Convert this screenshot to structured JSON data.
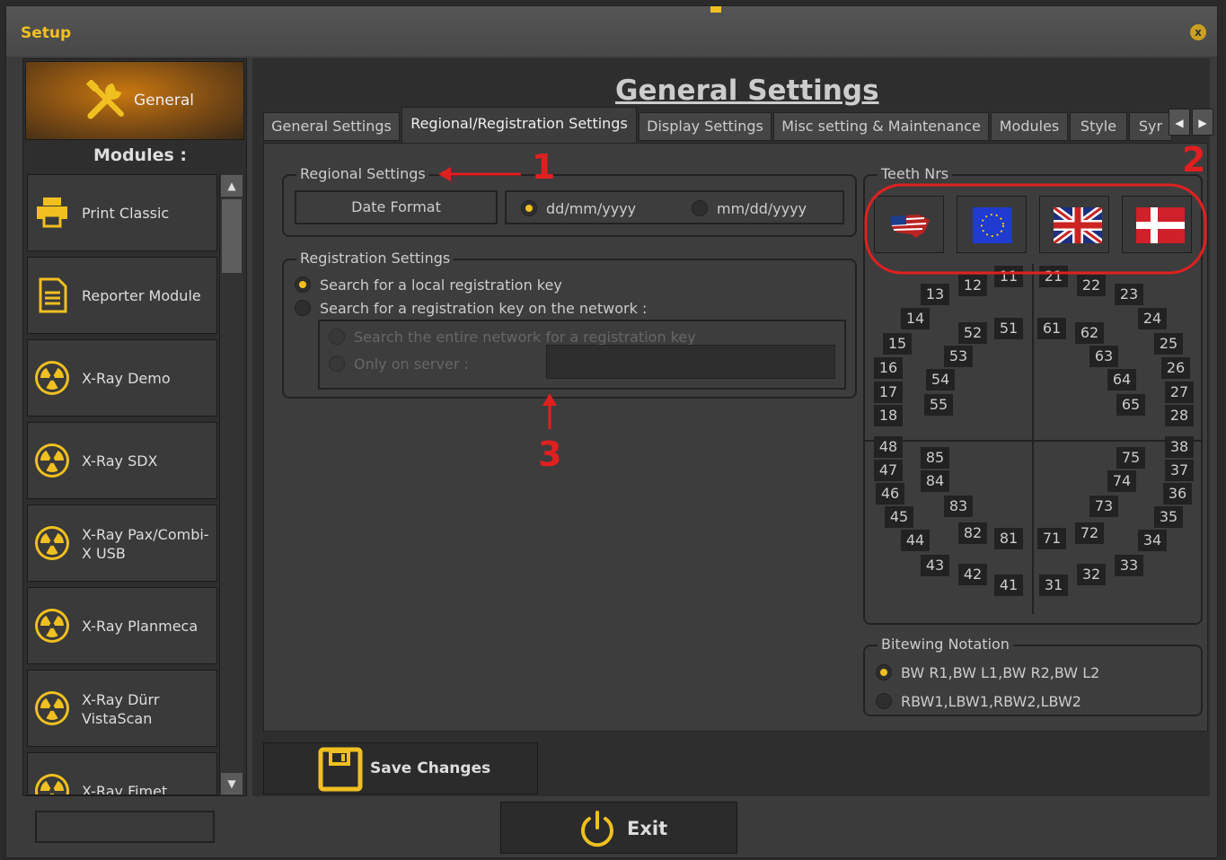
{
  "window": {
    "title": "Setup",
    "close_symbol": "x"
  },
  "sidebar": {
    "general_label": "General",
    "modules_heading": "Modules :",
    "items": [
      {
        "label": "Print Classic",
        "icon": "printer-icon"
      },
      {
        "label": "Reporter Module",
        "icon": "document-icon"
      },
      {
        "label": "X-Ray Demo",
        "icon": "radiation-icon"
      },
      {
        "label": "X-Ray SDX",
        "icon": "radiation-icon"
      },
      {
        "label": "X-Ray Pax/Combi-X USB",
        "icon": "radiation-icon"
      },
      {
        "label": "X-Ray Planmeca",
        "icon": "radiation-icon"
      },
      {
        "label": "X-Ray Dürr VistaScan",
        "icon": "radiation-icon"
      },
      {
        "label": "X-Ray Fimet",
        "icon": "radiation-icon"
      }
    ]
  },
  "main": {
    "title": "General Settings",
    "tabs": [
      {
        "label": "General Settings",
        "active": false
      },
      {
        "label": "Regional/Registration Settings",
        "active": true
      },
      {
        "label": "Display Settings",
        "active": false
      },
      {
        "label": "Misc setting & Maintenance",
        "active": false
      },
      {
        "label": "Modules",
        "active": false
      },
      {
        "label": "Style",
        "active": false
      },
      {
        "label": "Syr",
        "active": false
      }
    ],
    "regional": {
      "title": "Regional Settings",
      "date_format_label": "Date Format",
      "options": [
        "dd/mm/yyyy",
        "mm/dd/yyyy"
      ],
      "selected": "dd/mm/yyyy"
    },
    "registration": {
      "title": "Registration Settings",
      "options": [
        "Search for a local registration key",
        "Search for a registration key on the network :"
      ],
      "selected": "Search for a local registration key",
      "sub_options": [
        "Search the entire network for a registration key",
        "Only on server :"
      ],
      "server_value": ""
    },
    "teeth": {
      "title": "Teeth Nrs",
      "flags": [
        "usa-flag-icon",
        "eu-flag-icon",
        "uk-flag-icon",
        "denmark-flag-icon"
      ],
      "q1": [
        "11",
        "12",
        "13",
        "14",
        "15",
        "16",
        "17",
        "18"
      ],
      "q2": [
        "21",
        "22",
        "23",
        "24",
        "25",
        "26",
        "27",
        "28"
      ],
      "q5": [
        "51",
        "52",
        "53",
        "54",
        "55"
      ],
      "q6": [
        "61",
        "62",
        "63",
        "64",
        "65"
      ],
      "q4": [
        "48",
        "47",
        "46",
        "45",
        "44",
        "43",
        "42",
        "41"
      ],
      "q3": [
        "38",
        "37",
        "36",
        "35",
        "34",
        "33",
        "32",
        "31"
      ],
      "q8": [
        "85",
        "84",
        "83",
        "82",
        "81"
      ],
      "q7": [
        "75",
        "74",
        "73",
        "72",
        "71"
      ]
    },
    "bitewing": {
      "title": "Bitewing Notation",
      "options": [
        "BW R1,BW L1,BW R2,BW L2",
        "RBW1,LBW1,RBW2,LBW2"
      ],
      "selected": "BW R1,BW L1,BW R2,BW L2"
    },
    "save_label": "Save Changes"
  },
  "footer": {
    "input_value": "",
    "exit_label": "Exit"
  },
  "annotations": [
    "1",
    "2",
    "3"
  ],
  "colors": {
    "accent": "#f0c020",
    "annotation": "#e02020",
    "background": "#3d3d3d"
  }
}
